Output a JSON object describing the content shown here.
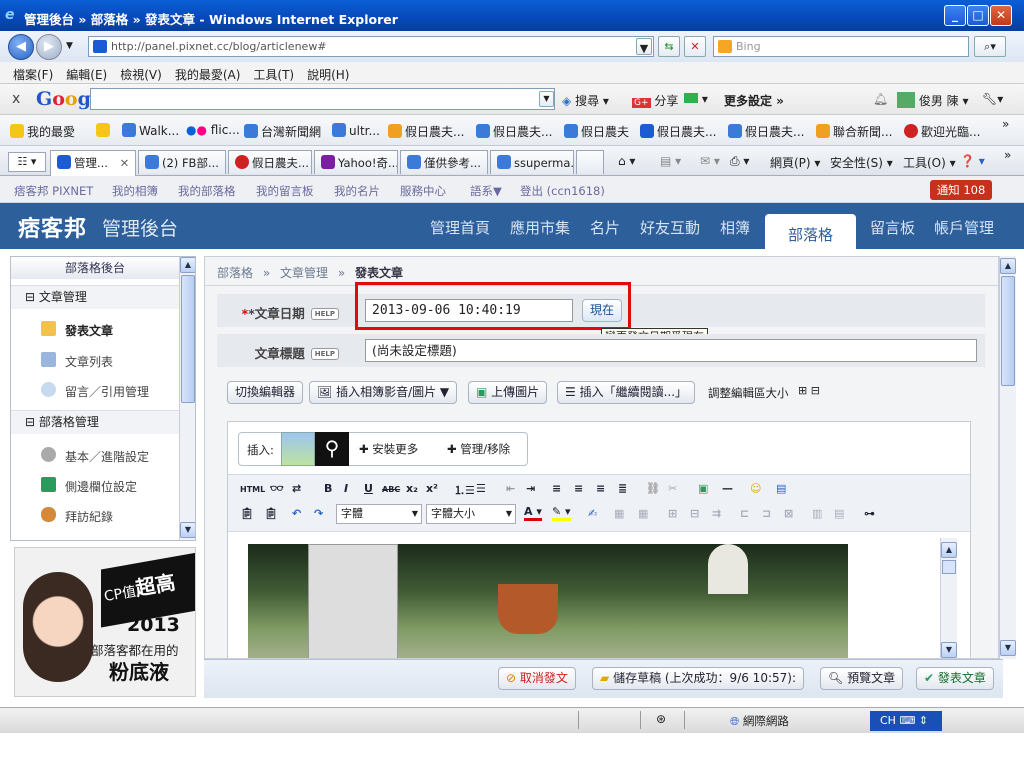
{
  "window": {
    "title": "管理後台 » 部落格 » 發表文章 - Windows Internet Explorer"
  },
  "browser": {
    "url": "http://panel.pixnet.cc/blog/articlenew#",
    "search_placeholder": "Bing",
    "menu": [
      "檔案(F)",
      "編輯(E)",
      "檢視(V)",
      "我的最愛(A)",
      "工具(T)",
      "說明(H)"
    ],
    "google_toolbar": {
      "brand": "Google",
      "search": "搜尋",
      "share": "分享",
      "more": "更多設定 »",
      "user": "俊男 陳"
    },
    "favorites": [
      "我的最愛",
      "Walk...",
      "flic...",
      "台灣新聞網",
      "ultr...",
      "假日農夫...",
      "假日農夫...",
      "假日農夫",
      "假日農夫...",
      "假日農夫...",
      "聯合新聞...",
      "歡迎光臨..."
    ],
    "tabs": [
      "管理...",
      "(2) FB部...",
      "假日農夫...",
      "Yahoo!奇...",
      "僅供參考...",
      "ssuperma..."
    ],
    "commands": [
      "網頁(P)",
      "安全性(S)",
      "工具(O)"
    ],
    "status": {
      "zone": "網際網路",
      "ime": "CH"
    }
  },
  "pixnet_top": {
    "links": [
      "痞客邦 PIXNET",
      "我的相簿",
      "我的部落格",
      "我的留言板",
      "我的名片",
      "服務中心",
      "語系▼",
      "登出 (ccn1618)"
    ],
    "notice": "通知 108"
  },
  "header": {
    "logo": "痞客邦",
    "subtitle": "管理後台",
    "nav": [
      "管理首頁",
      "應用市集",
      "名片",
      "好友互動",
      "相簿",
      "部落格",
      "留言板",
      "帳戶管理"
    ],
    "active_nav": "部落格"
  },
  "sidebar": {
    "title": "部落格後台",
    "group1": "文章管理",
    "items1": [
      "發表文章",
      "文章列表",
      "留言／引用管理"
    ],
    "group2": "部落格管理",
    "items2": [
      "基本／進階設定",
      "側邊欄位設定",
      "拜訪紀錄"
    ]
  },
  "ad": {
    "line1_a": "CP值",
    "line1_b": "超高",
    "line2": "2013",
    "line3": "部落客都在用的",
    "line4": "粉底液"
  },
  "content": {
    "breadcrumb": [
      "部落格",
      "文章管理",
      "發表文章"
    ],
    "date_label": "*文章日期",
    "help": "HELP",
    "date_value": "2013-09-06 10:40:19",
    "now_button": "現在",
    "tooltip": "變更發文日期爲現在",
    "title_label": "文章標題",
    "title_value": "(尚未設定標題)",
    "toolbar": {
      "switch_editor": "切換編輯器",
      "insert_media": "插入相簿影音/圖片 ▼",
      "upload": "上傳圖片",
      "insert_more": "插入「繼續閱讀...」",
      "resize": "調整編輯區大小"
    },
    "plugin": {
      "insert": "插入:",
      "install": "安裝更多",
      "manage": "管理/移除"
    },
    "font_select": "字體",
    "size_select": "字體大小"
  },
  "actions": {
    "cancel": "取消發文",
    "draft": "儲存草稿 (上次成功：9/6 10:57):",
    "preview": "預覽文章",
    "publish": "發表文章"
  }
}
